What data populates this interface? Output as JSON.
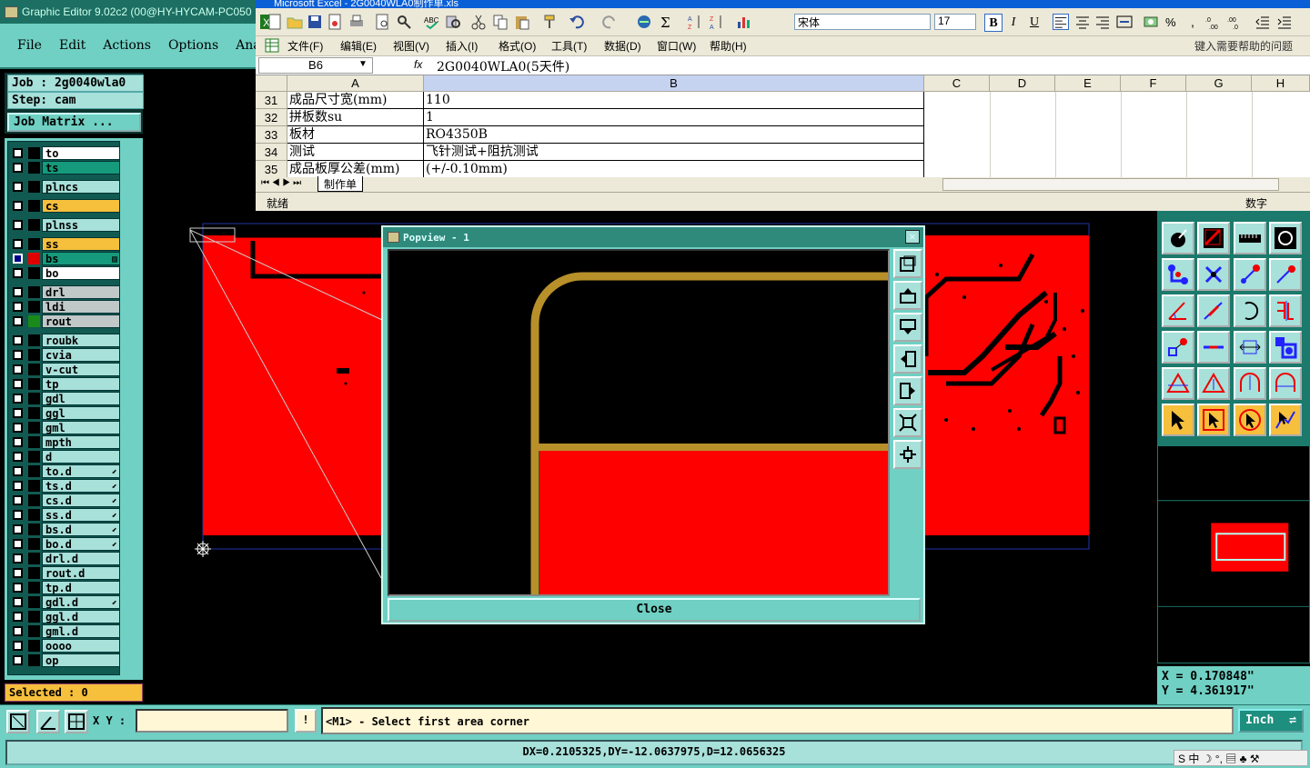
{
  "editor": {
    "title": "Graphic Editor 9.02c2 (00@HY-HYCAM-PC050",
    "menu": [
      "File",
      "Edit",
      "Actions",
      "Options",
      "Analysi"
    ],
    "job": "Job : 2g0040wla0",
    "step": "Step: cam",
    "job_matrix": "Job Matrix ...",
    "selected": "Selected : 0",
    "xy_label": "X Y :",
    "xy_value": "",
    "bang": "!",
    "prompt": "<M1> - Select first area corner",
    "unit": "Inch",
    "status": "DX=0.2105325,DY=-12.0637975,D=12.0656325",
    "coord_x": "X = 0.170848\"",
    "coord_y": "Y = 4.361917\"",
    "ime": "S 中 ☽ °, ▤ ♣ ⚒"
  },
  "layers": [
    {
      "name": "to",
      "color": "#ffffff",
      "swatch": "#000000",
      "checked": false,
      "mark": ""
    },
    {
      "name": "ts",
      "color": "#169a7c",
      "swatch": "#000000",
      "checked": false,
      "mark": ""
    },
    {
      "name": "plncs",
      "color": "#a8e0da",
      "swatch": "#000000",
      "checked": false,
      "mark": ""
    },
    {
      "name": "cs",
      "color": "#f6bf3c",
      "swatch": "#000000",
      "checked": false,
      "mark": ""
    },
    {
      "name": "plnss",
      "color": "#a8e0da",
      "swatch": "#000000",
      "checked": false,
      "mark": ""
    },
    {
      "name": "ss",
      "color": "#f6bf3c",
      "swatch": "#000000",
      "checked": false,
      "mark": ""
    },
    {
      "name": "bs",
      "color": "#169a7c",
      "swatch": "#e00000",
      "checked": true,
      "mark": "▨"
    },
    {
      "name": "bo",
      "color": "#ffffff",
      "swatch": "#000000",
      "checked": false,
      "mark": ""
    },
    {
      "name": "drl",
      "color": "#c0c8c8",
      "swatch": "#000000",
      "checked": false,
      "mark": ""
    },
    {
      "name": "ldi",
      "color": "#c0c8c8",
      "swatch": "#000000",
      "checked": false,
      "mark": ""
    },
    {
      "name": "rout",
      "color": "#c0c8c8",
      "swatch": "#1a8a1a",
      "checked": false,
      "mark": ""
    },
    {
      "name": "roubk",
      "color": "#a8e0da",
      "swatch": "#000000",
      "checked": false,
      "mark": ""
    },
    {
      "name": "cvia",
      "color": "#a8e0da",
      "swatch": "#000000",
      "checked": false,
      "mark": ""
    },
    {
      "name": "v-cut",
      "color": "#a8e0da",
      "swatch": "#000000",
      "checked": false,
      "mark": ""
    },
    {
      "name": "tp",
      "color": "#a8e0da",
      "swatch": "#000000",
      "checked": false,
      "mark": ""
    },
    {
      "name": "gdl",
      "color": "#a8e0da",
      "swatch": "#000000",
      "checked": false,
      "mark": ""
    },
    {
      "name": "ggl",
      "color": "#a8e0da",
      "swatch": "#000000",
      "checked": false,
      "mark": ""
    },
    {
      "name": "gml",
      "color": "#a8e0da",
      "swatch": "#000000",
      "checked": false,
      "mark": ""
    },
    {
      "name": "mpth",
      "color": "#a8e0da",
      "swatch": "#000000",
      "checked": false,
      "mark": ""
    },
    {
      "name": "d",
      "color": "#a8e0da",
      "swatch": "#000000",
      "checked": false,
      "mark": ""
    },
    {
      "name": "to.d",
      "color": "#a8e0da",
      "swatch": "#000000",
      "checked": false,
      "mark": "⬋"
    },
    {
      "name": "ts.d",
      "color": "#a8e0da",
      "swatch": "#000000",
      "checked": false,
      "mark": "⬋"
    },
    {
      "name": "cs.d",
      "color": "#a8e0da",
      "swatch": "#000000",
      "checked": false,
      "mark": "⬋"
    },
    {
      "name": "ss.d",
      "color": "#a8e0da",
      "swatch": "#000000",
      "checked": false,
      "mark": "⬋"
    },
    {
      "name": "bs.d",
      "color": "#a8e0da",
      "swatch": "#000000",
      "checked": false,
      "mark": "⬋"
    },
    {
      "name": "bo.d",
      "color": "#a8e0da",
      "swatch": "#000000",
      "checked": false,
      "mark": "⬋"
    },
    {
      "name": "drl.d",
      "color": "#a8e0da",
      "swatch": "#000000",
      "checked": false,
      "mark": ""
    },
    {
      "name": "rout.d",
      "color": "#a8e0da",
      "swatch": "#000000",
      "checked": false,
      "mark": ""
    },
    {
      "name": "tp.d",
      "color": "#a8e0da",
      "swatch": "#000000",
      "checked": false,
      "mark": ""
    },
    {
      "name": "gdl.d",
      "color": "#a8e0da",
      "swatch": "#000000",
      "checked": false,
      "mark": "⬋"
    },
    {
      "name": "ggl.d",
      "color": "#a8e0da",
      "swatch": "#000000",
      "checked": false,
      "mark": ""
    },
    {
      "name": "gml.d",
      "color": "#a8e0da",
      "swatch": "#000000",
      "checked": false,
      "mark": ""
    },
    {
      "name": "oooo",
      "color": "#a8e0da",
      "swatch": "#000000",
      "checked": false,
      "mark": ""
    },
    {
      "name": "op",
      "color": "#a8e0da",
      "swatch": "#000000",
      "checked": false,
      "mark": ""
    }
  ],
  "excel": {
    "title": "Microsoft Excel - 2G0040WLA0制作单.xls",
    "font": "宋体",
    "size": "17",
    "menu": [
      "文件(F)",
      "编辑(E)",
      "视图(V)",
      "插入(I)",
      "格式(O)",
      "工具(T)",
      "数据(D)",
      "窗口(W)",
      "帮助(H)"
    ],
    "help_prompt": "键入需要帮助的问题",
    "name_box": "B6",
    "fx": "fx",
    "formula": "2G0040WLA0(5天件)",
    "columns": [
      "A",
      "B",
      "C",
      "D",
      "E",
      "F",
      "G",
      "H"
    ],
    "rows": [
      {
        "num": "31",
        "a": "成品尺寸宽(mm)",
        "b": "110"
      },
      {
        "num": "32",
        "a": "拼板数su",
        "b": "1"
      },
      {
        "num": "33",
        "a": "板材",
        "b": "RO4350B"
      },
      {
        "num": "34",
        "a": "测试",
        "b": "飞针测试+阻抗测试"
      },
      {
        "num": "35",
        "a": "成品板厚公差(mm)",
        "b": "(+/-0.10mm)"
      }
    ],
    "sheet_tab": "制作单",
    "status_left": "就绪",
    "status_right": "数字"
  },
  "popview": {
    "title": "Popview - 1",
    "close_x": "✕",
    "close_label": "Close"
  },
  "colors": {
    "board_red": "#ff0000",
    "trace_gold": "#b8902a",
    "panel_teal": "#6fd0c3"
  }
}
